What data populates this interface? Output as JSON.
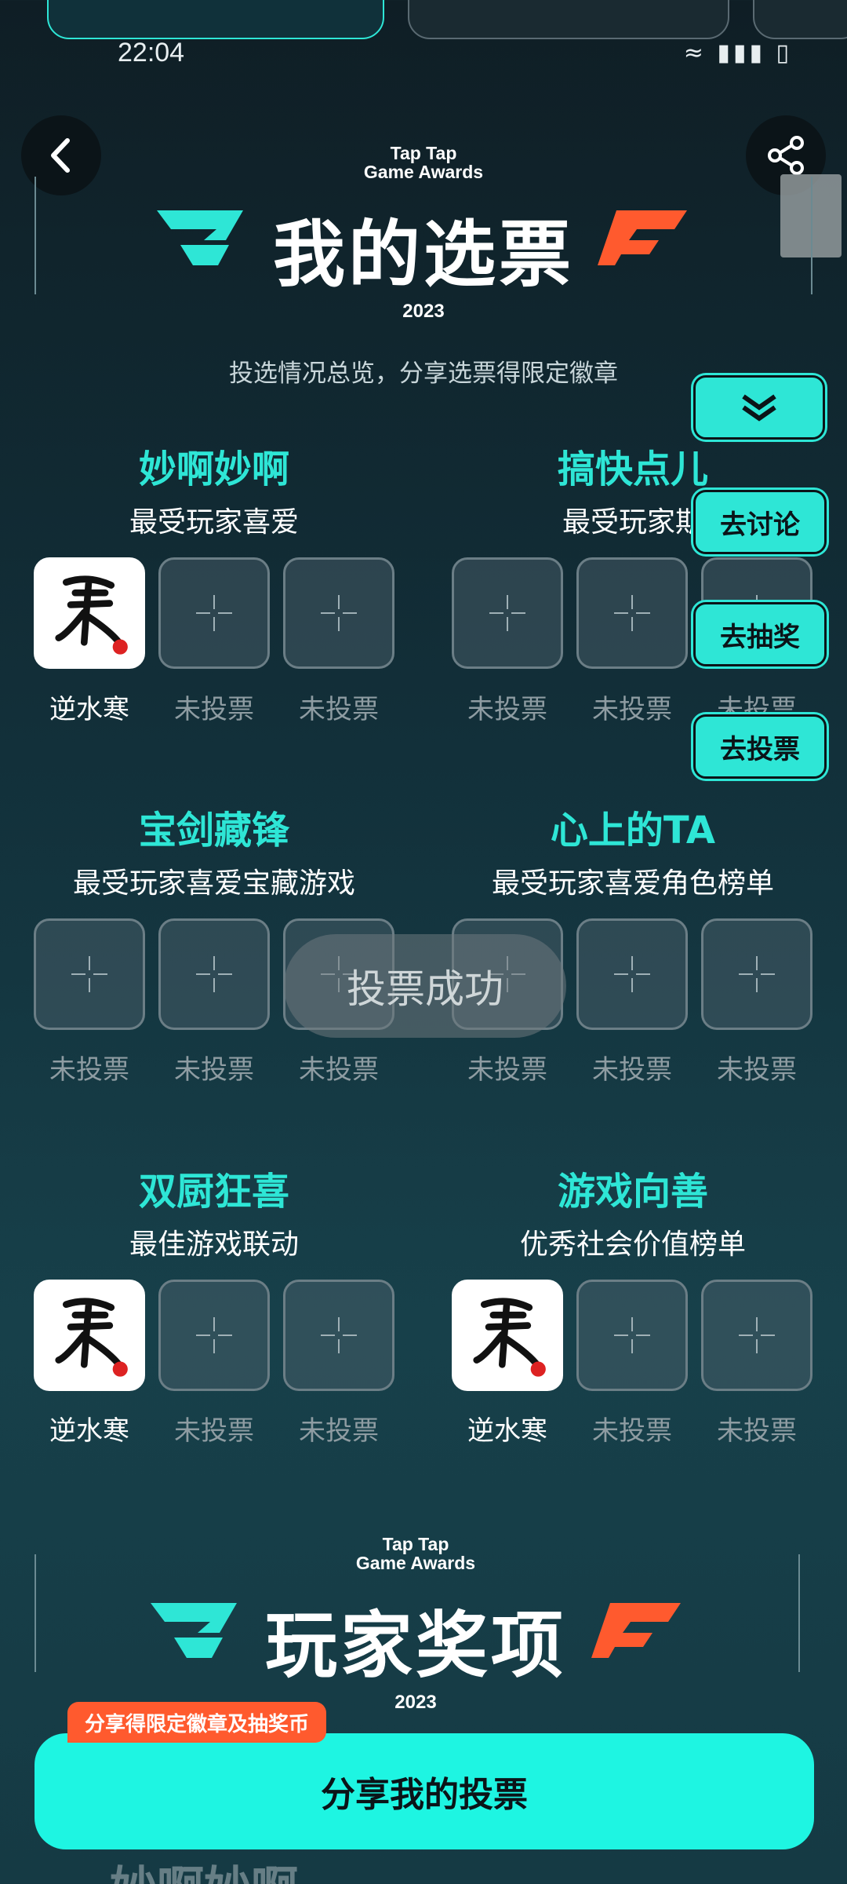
{
  "status": {
    "time": "22:04",
    "icons": "≈ ▮▮▮ ▯"
  },
  "header": {
    "brand_line1": "Tap Tap",
    "brand_line2": "Game Awards",
    "title": "我的选票",
    "year": "2023",
    "subtitle": "投选情况总览，分享选票得限定徽章"
  },
  "categories": [
    {
      "title": "妙啊妙啊",
      "subtitle": "最受玩家喜爱",
      "slots": [
        "逆水寒",
        "未投票",
        "未投票"
      ]
    },
    {
      "title": "搞快点儿",
      "subtitle": "最受玩家期",
      "slots": [
        "未投票",
        "未投票",
        "未投票"
      ]
    },
    {
      "title": "宝剑藏锋",
      "subtitle": "最受玩家喜爱宝藏游戏",
      "slots": [
        "未投票",
        "未投票",
        "未投票"
      ]
    },
    {
      "title": "心上的TA",
      "subtitle": "最受玩家喜爱角色榜单",
      "slots": [
        "未投票",
        "未投票",
        "未投票"
      ]
    },
    {
      "title": "双厨狂喜",
      "subtitle": "最佳游戏联动",
      "slots": [
        "逆水寒",
        "未投票",
        "未投票"
      ]
    },
    {
      "title": "游戏向善",
      "subtitle": "优秀社会价值榜单",
      "slots": [
        "逆水寒",
        "未投票",
        "未投票"
      ]
    }
  ],
  "side_buttons": {
    "discuss": "去讨论",
    "lottery": "去抽奖",
    "vote": "去投票"
  },
  "toast": "投票成功",
  "section2": {
    "brand_line1": "Tap Tap",
    "brand_line2": "Game Awards",
    "title": "玩家奖项",
    "year": "2023"
  },
  "share": {
    "badge": "分享得限定徽章及抽奖币",
    "button": "分享我的投票"
  },
  "bottom_peek": "妙啊妙啊",
  "colors": {
    "accent": "#2ee6d6",
    "orange": "#ff5a2e",
    "background": "#12303a"
  }
}
